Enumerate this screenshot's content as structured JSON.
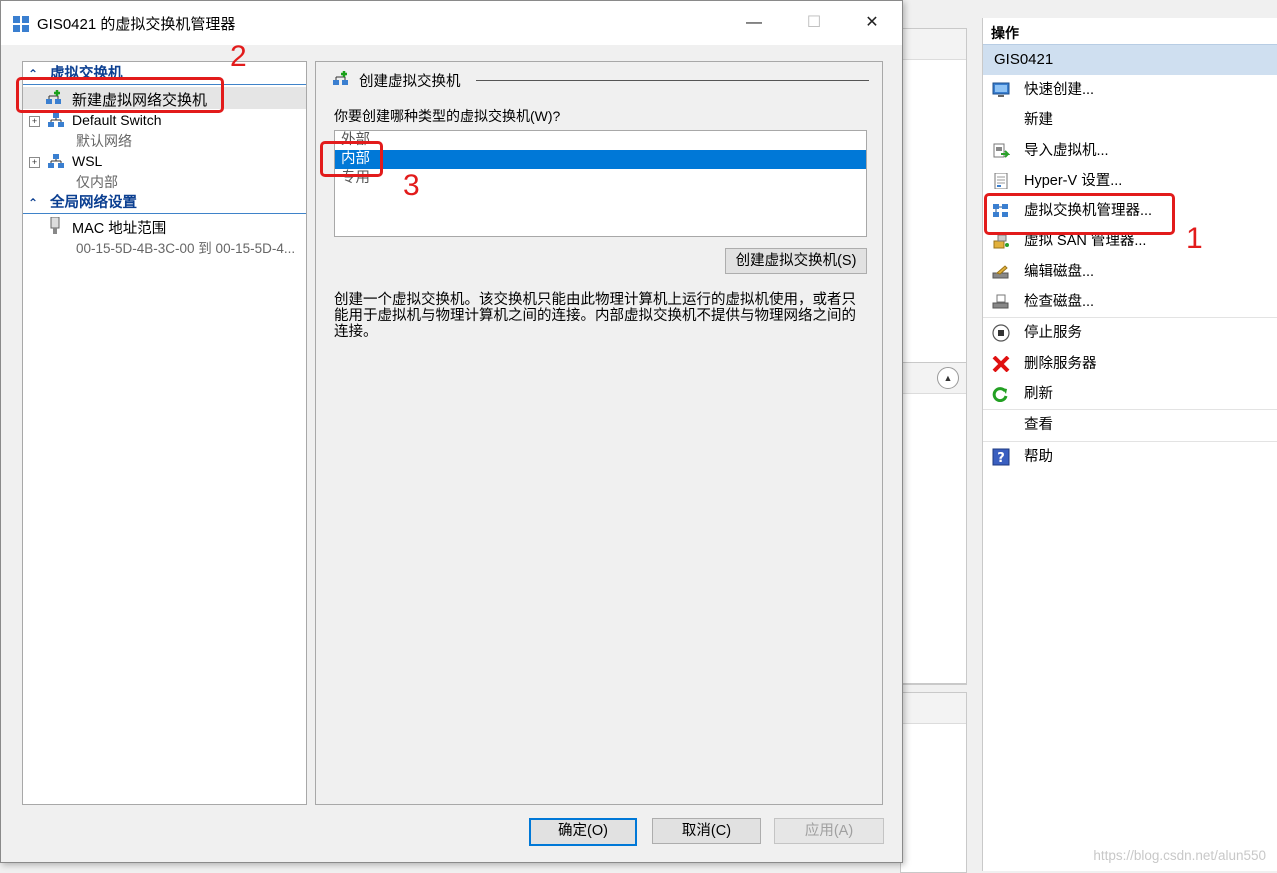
{
  "dialog": {
    "title": "GIS0421 的虚拟交换机管理器",
    "minimize": "—",
    "maximize": "☐",
    "close": "✕"
  },
  "tree": {
    "section_switches": "虚拟交换机",
    "new_switch": "新建虚拟网络交换机",
    "switches": [
      {
        "name": "Default Switch",
        "type": "默认网络"
      },
      {
        "name": "WSL",
        "type": "仅内部"
      }
    ],
    "section_global": "全局网络设置",
    "mac_label": "MAC 地址范围",
    "mac_value": "00-15-5D-4B-3C-00 到 00-15-5D-4..."
  },
  "create": {
    "group_title": "创建虚拟交换机",
    "prompt": "你要创建哪种类型的虚拟交换机(W)?",
    "types": [
      "外部",
      "内部",
      "专用"
    ],
    "selected": "内部",
    "create_button": "创建虚拟交换机(S)",
    "description": "创建一个虚拟交换机。该交换机只能由此物理计算机上运行的虚拟机使用，或者只能用于虚拟机与物理计算机之间的连接。内部虚拟交换机不提供与物理网络之间的连接。"
  },
  "footer": {
    "ok": "确定(O)",
    "cancel": "取消(C)",
    "apply": "应用(A)"
  },
  "actions": {
    "title": "操作",
    "server": "GIS0421",
    "items": [
      {
        "label": "快速创建...",
        "icon": "quick-create-icon"
      },
      {
        "label": "新建",
        "icon": ""
      },
      {
        "label": "导入虚拟机...",
        "icon": "import-vm-icon"
      },
      {
        "label": "Hyper-V 设置...",
        "icon": "settings-doc-icon"
      },
      {
        "label": "虚拟交换机管理器...",
        "icon": "switch-manager-icon"
      },
      {
        "label": "虚拟 SAN 管理器...",
        "icon": "san-manager-icon"
      },
      {
        "label": "编辑磁盘...",
        "icon": "edit-disk-icon"
      },
      {
        "label": "检查磁盘...",
        "icon": "inspect-disk-icon"
      },
      {
        "label": "停止服务",
        "icon": "stop-service-icon"
      },
      {
        "label": "删除服务器",
        "icon": "remove-server-icon"
      },
      {
        "label": "刷新",
        "icon": "refresh-icon"
      },
      {
        "label": "查看",
        "icon": ""
      },
      {
        "label": "帮助",
        "icon": "help-icon"
      }
    ]
  },
  "annotations": [
    "1",
    "2",
    "3"
  ],
  "watermark": "https://blog.csdn.net/alun550",
  "colors": {
    "selection": "#0078d7",
    "annotation": "#e21b1b",
    "section_text": "#0b3f91",
    "actions_group": "#cfdff0"
  }
}
